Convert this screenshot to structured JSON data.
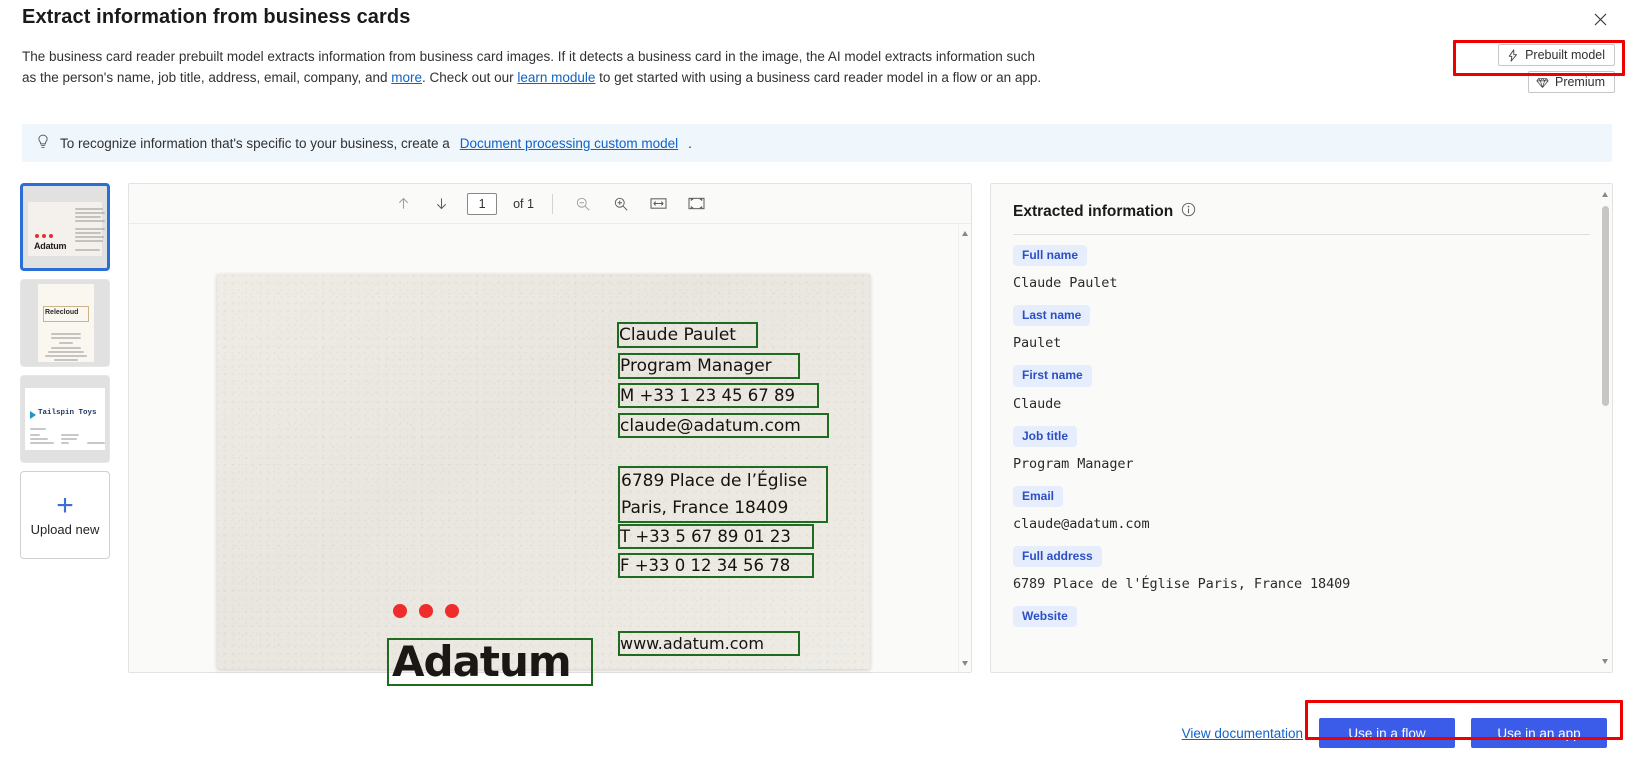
{
  "header": {
    "title": "Extract information from business cards",
    "close_icon": "close-icon"
  },
  "intro": {
    "part1": "The business card reader prebuilt model extracts information from business card images. If it detects a business card in the image, the AI model extracts information such as the person's name, job title, address, email, company, and ",
    "link1": "more",
    "part2": ". Check out our ",
    "link2": "learn module",
    "part3": " to get started with using a business card reader model in a flow or an app."
  },
  "badges": [
    {
      "label": "Prebuilt model",
      "icon": "lightning-bolt-icon"
    },
    {
      "label": "Premium",
      "icon": "diamond-icon"
    }
  ],
  "info_bar": {
    "icon": "lightbulb-icon",
    "text_before": "To recognize information that's specific to your business, create a ",
    "link": "Document processing custom model",
    "text_after": "."
  },
  "thumbnails": {
    "items": [
      {
        "name": "Adatum",
        "selected": true
      },
      {
        "name": "Relecloud",
        "selected": false
      },
      {
        "name": "Tailspin Toys",
        "selected": false
      }
    ],
    "upload": {
      "label": "Upload new",
      "icon": "plus-icon"
    }
  },
  "viewer": {
    "toolbar": {
      "previous_icon": "arrow-up-icon",
      "next_icon": "arrow-down-icon",
      "page_value": "1",
      "page_total": "of 1",
      "zoom_out_icon": "zoom-out-icon",
      "zoom_in_icon": "zoom-in-icon",
      "fit_width_icon": "fit-width-icon",
      "fit_page_icon": "fit-page-icon"
    },
    "card": {
      "company": "Adatum",
      "ocr_boxes": [
        {
          "text": "Claude Paulet"
        },
        {
          "text": "Program Manager"
        },
        {
          "text": "M +33 1 23 45 67 89"
        },
        {
          "text": "claude@adatum.com"
        },
        {
          "text": "6789 Place de l’Église"
        },
        {
          "text": "Paris, France 18409"
        },
        {
          "text": "T +33 5 67 89 01 23"
        },
        {
          "text": "F +33 0 12 34 56 78"
        },
        {
          "text": "www.adatum.com"
        }
      ]
    }
  },
  "extracted": {
    "title": "Extracted information",
    "info_icon": "info-circle-icon",
    "fields": [
      {
        "label": "Full name",
        "value": "Claude Paulet"
      },
      {
        "label": "Last name",
        "value": "Paulet"
      },
      {
        "label": "First name",
        "value": "Claude"
      },
      {
        "label": "Job title",
        "value": "Program Manager"
      },
      {
        "label": "Email",
        "value": "claude@adatum.com"
      },
      {
        "label": "Full address",
        "value": "6789 Place de l'Église Paris, France 18409"
      },
      {
        "label": "Website",
        "value": ""
      }
    ]
  },
  "footer": {
    "documentation_link": "View documentation",
    "use_in_flow": "Use in a flow",
    "use_in_app": "Use in an app"
  },
  "colors": {
    "accent_blue": "#3b5ce8",
    "link_blue": "#0f63c8",
    "badge_bg": "#e6edfd",
    "badge_text": "#2c4fc4",
    "ocr_box": "#1f6b1f",
    "annotation_red": "#ee0000",
    "info_bar_bg": "#eff6fc",
    "logo_dot_red": "#ef2b2b"
  }
}
